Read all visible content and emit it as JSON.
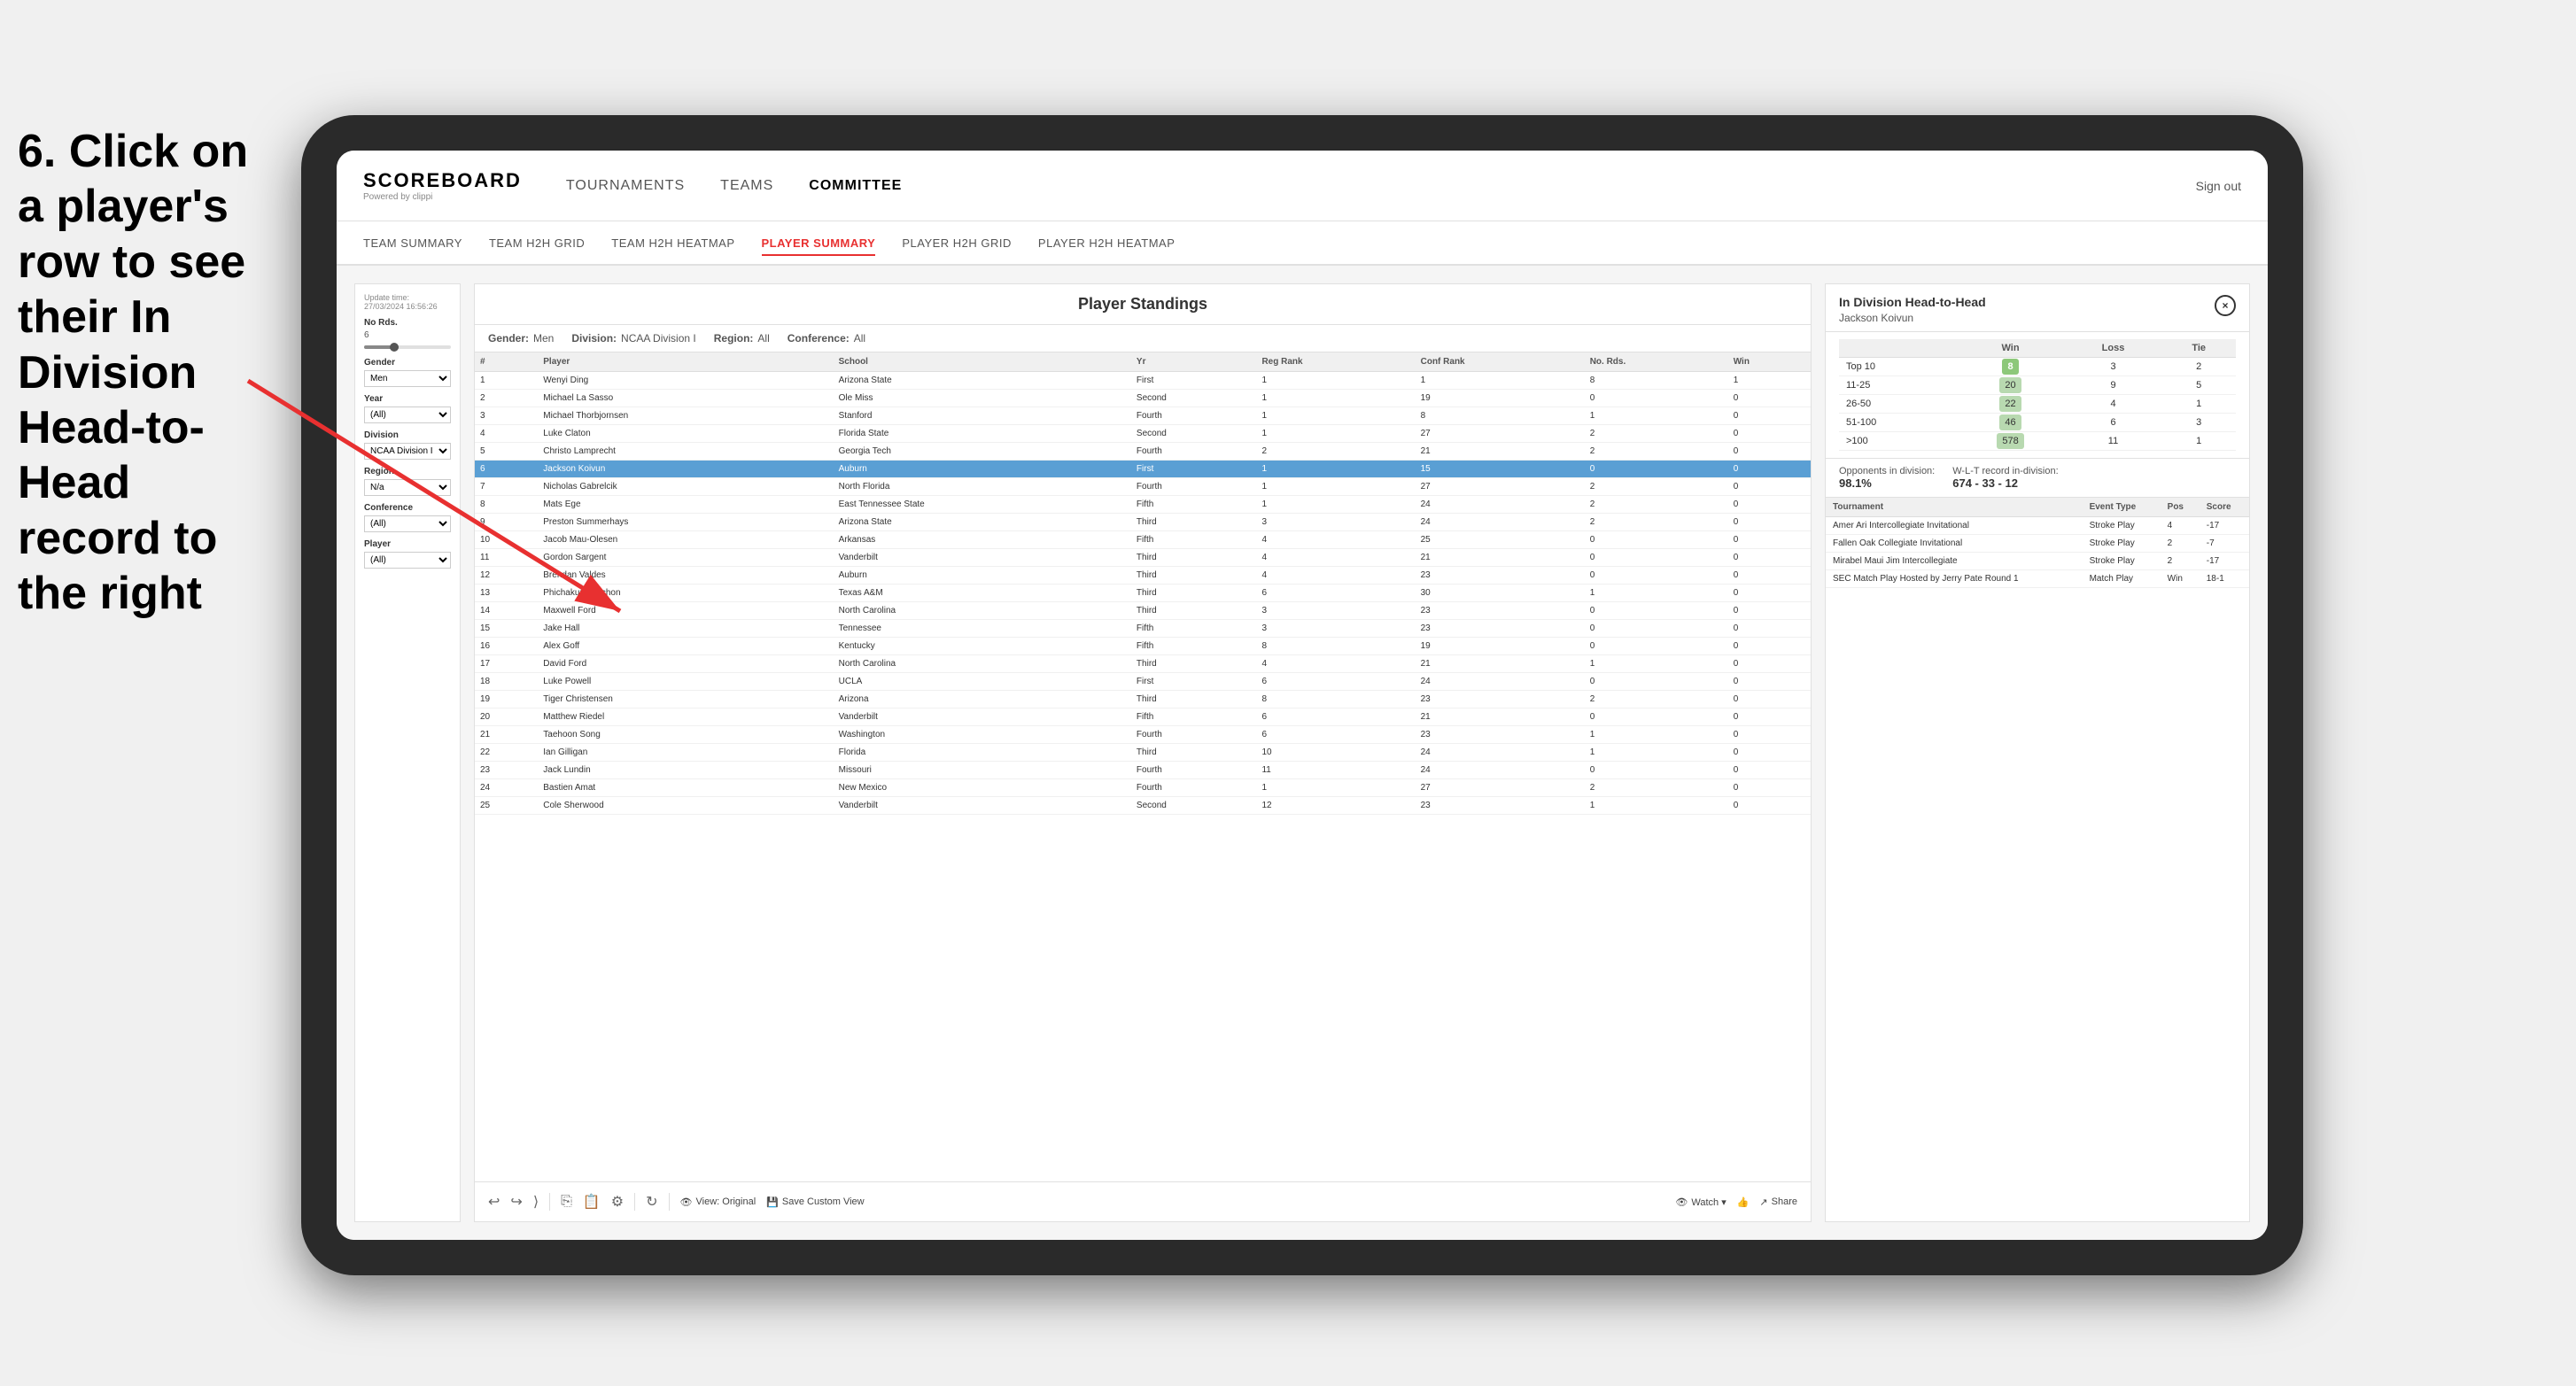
{
  "page": {
    "background": "#f0f0f0"
  },
  "instruction": {
    "text": "6. Click on a player's row to see their In Division Head-to-Head record to the right"
  },
  "nav": {
    "logo_title": "SCOREBOARD",
    "logo_subtitle": "Powered by clippi",
    "items": [
      {
        "label": "TOURNAMENTS",
        "active": false
      },
      {
        "label": "TEAMS",
        "active": false
      },
      {
        "label": "COMMITTEE",
        "active": true
      }
    ],
    "sign_out": "Sign out"
  },
  "sub_nav": {
    "items": [
      {
        "label": "TEAM SUMMARY",
        "active": false
      },
      {
        "label": "TEAM H2H GRID",
        "active": false
      },
      {
        "label": "TEAM H2H HEATMAP",
        "active": false
      },
      {
        "label": "PLAYER SUMMARY",
        "active": true
      },
      {
        "label": "PLAYER H2H GRID",
        "active": false
      },
      {
        "label": "PLAYER H2H HEATMAP",
        "active": false
      }
    ]
  },
  "filters": {
    "update_label": "Update time:",
    "update_time": "27/03/2024 16:56:26",
    "no_rds_label": "No Rds.",
    "no_rds_value": "6",
    "gender_label": "Gender",
    "gender_value": "Men",
    "year_label": "Year",
    "year_value": "(All)",
    "division_label": "Division",
    "division_value": "NCAA Division I",
    "region_label": "Region",
    "region_value": "N/a",
    "conference_label": "Conference",
    "conference_value": "(All)",
    "player_label": "Player",
    "player_value": "(All)"
  },
  "standings": {
    "title": "Player Standings",
    "gender": "Men",
    "division": "NCAA Division I",
    "region": "All",
    "conference": "All",
    "columns": [
      "#",
      "Player",
      "School",
      "Yr",
      "Reg Rank",
      "Conf Rank",
      "No. Rds.",
      "Win"
    ],
    "rows": [
      {
        "num": 1,
        "player": "Wenyi Ding",
        "school": "Arizona State",
        "yr": "First",
        "reg": 1,
        "conf": 1,
        "rds": 8,
        "win": 1
      },
      {
        "num": 2,
        "player": "Michael La Sasso",
        "school": "Ole Miss",
        "yr": "Second",
        "reg": 1,
        "conf": 19,
        "rds": 0,
        "win": 0
      },
      {
        "num": 3,
        "player": "Michael Thorbjornsen",
        "school": "Stanford",
        "yr": "Fourth",
        "reg": 1,
        "conf": 8,
        "rds": 1,
        "win": 0
      },
      {
        "num": 4,
        "player": "Luke Claton",
        "school": "Florida State",
        "yr": "Second",
        "reg": 1,
        "conf": 27,
        "rds": 2,
        "win": 0
      },
      {
        "num": 5,
        "player": "Christo Lamprecht",
        "school": "Georgia Tech",
        "yr": "Fourth",
        "reg": 2,
        "conf": 21,
        "rds": 2,
        "win": 0
      },
      {
        "num": 6,
        "player": "Jackson Koivun",
        "school": "Auburn",
        "yr": "First",
        "reg": 1,
        "conf": 15,
        "rds": 0,
        "win": 0,
        "selected": true
      },
      {
        "num": 7,
        "player": "Nicholas Gabrelcik",
        "school": "North Florida",
        "yr": "Fourth",
        "reg": 1,
        "conf": 27,
        "rds": 2,
        "win": 0
      },
      {
        "num": 8,
        "player": "Mats Ege",
        "school": "East Tennessee State",
        "yr": "Fifth",
        "reg": 1,
        "conf": 24,
        "rds": 2,
        "win": 0
      },
      {
        "num": 9,
        "player": "Preston Summerhays",
        "school": "Arizona State",
        "yr": "Third",
        "reg": 3,
        "conf": 24,
        "rds": 2,
        "win": 0
      },
      {
        "num": 10,
        "player": "Jacob Mau-Olesen",
        "school": "Arkansas",
        "yr": "Fifth",
        "reg": 4,
        "conf": 25,
        "rds": 0,
        "win": 0
      },
      {
        "num": 11,
        "player": "Gordon Sargent",
        "school": "Vanderbilt",
        "yr": "Third",
        "reg": 4,
        "conf": 21,
        "rds": 0,
        "win": 0
      },
      {
        "num": 12,
        "player": "Brendan Valdes",
        "school": "Auburn",
        "yr": "Third",
        "reg": 4,
        "conf": 23,
        "rds": 0,
        "win": 0
      },
      {
        "num": 13,
        "player": "Phichakun Maichon",
        "school": "Texas A&M",
        "yr": "Third",
        "reg": 6,
        "conf": 30,
        "rds": 1,
        "win": 0
      },
      {
        "num": 14,
        "player": "Maxwell Ford",
        "school": "North Carolina",
        "yr": "Third",
        "reg": 3,
        "conf": 23,
        "rds": 0,
        "win": 0
      },
      {
        "num": 15,
        "player": "Jake Hall",
        "school": "Tennessee",
        "yr": "Fifth",
        "reg": 3,
        "conf": 23,
        "rds": 0,
        "win": 0
      },
      {
        "num": 16,
        "player": "Alex Goff",
        "school": "Kentucky",
        "yr": "Fifth",
        "reg": 8,
        "conf": 19,
        "rds": 0,
        "win": 0
      },
      {
        "num": 17,
        "player": "David Ford",
        "school": "North Carolina",
        "yr": "Third",
        "reg": 4,
        "conf": 21,
        "rds": 1,
        "win": 0
      },
      {
        "num": 18,
        "player": "Luke Powell",
        "school": "UCLA",
        "yr": "First",
        "reg": 6,
        "conf": 24,
        "rds": 0,
        "win": 0
      },
      {
        "num": 19,
        "player": "Tiger Christensen",
        "school": "Arizona",
        "yr": "Third",
        "reg": 8,
        "conf": 23,
        "rds": 2,
        "win": 0
      },
      {
        "num": 20,
        "player": "Matthew Riedel",
        "school": "Vanderbilt",
        "yr": "Fifth",
        "reg": 6,
        "conf": 21,
        "rds": 0,
        "win": 0
      },
      {
        "num": 21,
        "player": "Taehoon Song",
        "school": "Washington",
        "yr": "Fourth",
        "reg": 6,
        "conf": 23,
        "rds": 1,
        "win": 0
      },
      {
        "num": 22,
        "player": "Ian Gilligan",
        "school": "Florida",
        "yr": "Third",
        "reg": 10,
        "conf": 24,
        "rds": 1,
        "win": 0
      },
      {
        "num": 23,
        "player": "Jack Lundin",
        "school": "Missouri",
        "yr": "Fourth",
        "reg": 11,
        "conf": 24,
        "rds": 0,
        "win": 0
      },
      {
        "num": 24,
        "player": "Bastien Amat",
        "school": "New Mexico",
        "yr": "Fourth",
        "reg": 1,
        "conf": 27,
        "rds": 2,
        "win": 0
      },
      {
        "num": 25,
        "player": "Cole Sherwood",
        "school": "Vanderbilt",
        "yr": "Second",
        "reg": 12,
        "conf": 23,
        "rds": 1,
        "win": 0
      }
    ]
  },
  "h2h": {
    "title": "In Division Head-to-Head",
    "player_name": "Jackson Koivun",
    "close_label": "×",
    "rank_table": {
      "columns": [
        "",
        "Win",
        "Loss",
        "Tie"
      ],
      "rows": [
        {
          "range": "Top 10",
          "win": 8,
          "loss": 3,
          "tie": 2,
          "win_strong": true
        },
        {
          "range": "11-25",
          "win": 20,
          "loss": 9,
          "tie": 5,
          "win_strong": false
        },
        {
          "range": "26-50",
          "win": 22,
          "loss": 4,
          "tie": 1,
          "win_strong": false
        },
        {
          "range": "51-100",
          "win": 46,
          "loss": 6,
          "tie": 3,
          "win_strong": false
        },
        {
          "range": ">100",
          "win": 578,
          "loss": 11,
          "tie": 1,
          "win_strong": false
        }
      ]
    },
    "opponents_label": "Opponents in division:",
    "opponents_pct": "98.1%",
    "record_label": "W-L-T record in-division:",
    "record_value": "674 - 33 - 12",
    "tournament_columns": [
      "Tournament",
      "Event Type",
      "Pos",
      "Score"
    ],
    "tournaments": [
      {
        "name": "Amer Ari Intercollegiate Invitational",
        "type": "Stroke Play",
        "pos": 4,
        "score": -17
      },
      {
        "name": "Fallen Oak Collegiate Invitational",
        "type": "Stroke Play",
        "pos": 2,
        "score": -7
      },
      {
        "name": "Mirabel Maui Jim Intercollegiate",
        "type": "Stroke Play",
        "pos": 2,
        "score": -17
      },
      {
        "name": "SEC Match Play Hosted by Jerry Pate Round 1",
        "type": "Match Play",
        "pos": "Win",
        "score": "18-1"
      }
    ]
  },
  "toolbar": {
    "view_original": "View: Original",
    "save_custom": "Save Custom View",
    "watch": "Watch ▾",
    "share": "Share"
  }
}
